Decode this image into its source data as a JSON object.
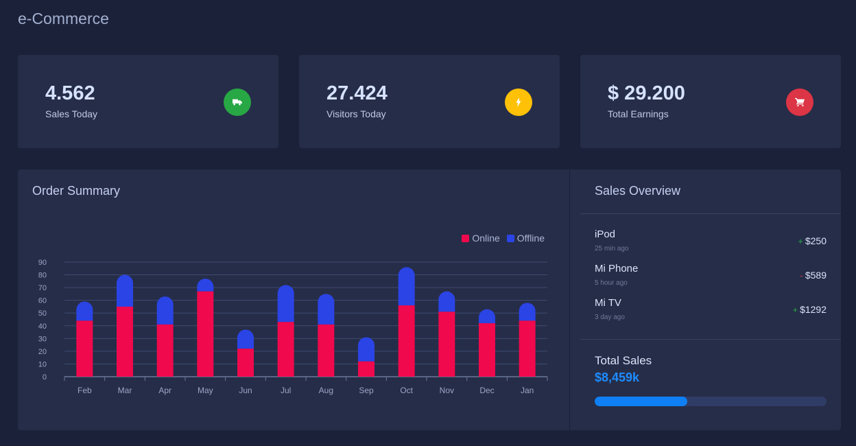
{
  "page": {
    "title": "e-Commerce"
  },
  "stats": [
    {
      "value": "4.562",
      "label": "Sales Today",
      "icon": "truck-icon",
      "color": "#28a745"
    },
    {
      "value": "27.424",
      "label": "Visitors Today",
      "icon": "bolt-icon",
      "color": "#ffc107"
    },
    {
      "value": "$ 29.200",
      "label": "Total Earnings",
      "icon": "cart-icon",
      "color": "#dc3545"
    }
  ],
  "order_summary": {
    "title": "Order Summary",
    "legend": {
      "online": "Online",
      "offline": "Offline"
    },
    "colors": {
      "online": "#f0094c",
      "offline": "#2b44e6"
    }
  },
  "chart_data": {
    "type": "bar",
    "stacked": true,
    "categories": [
      "Feb",
      "Mar",
      "Apr",
      "May",
      "Jun",
      "Jul",
      "Aug",
      "Sep",
      "Oct",
      "Nov",
      "Dec",
      "Jan"
    ],
    "series": [
      {
        "name": "Online",
        "values": [
          44,
          55,
          41,
          67,
          22,
          43,
          41,
          12,
          56,
          51,
          42,
          44
        ]
      },
      {
        "name": "Offline",
        "values": [
          15,
          25,
          22,
          10,
          15,
          29,
          24,
          19,
          30,
          16,
          11,
          14
        ]
      }
    ],
    "ylim": [
      0,
      90
    ],
    "yticks": [
      0,
      10,
      20,
      30,
      40,
      50,
      60,
      70,
      80,
      90
    ],
    "grid": true,
    "legend_position": "top-right"
  },
  "sales_overview": {
    "title": "Sales Overview",
    "items": [
      {
        "name": "iPod",
        "time": "25 min ago",
        "sign": "+",
        "amount": "$250",
        "sign_color": "#28a745"
      },
      {
        "name": "Mi Phone",
        "time": "5 hour ago",
        "sign": "-",
        "amount": "$589",
        "sign_color": "#dc3545"
      },
      {
        "name": "Mi TV",
        "time": "3 day ago",
        "sign": "+",
        "amount": "$1292",
        "sign_color": "#28a745"
      }
    ],
    "total_label": "Total Sales",
    "total_value": "$8,459k",
    "progress": 0.4
  }
}
